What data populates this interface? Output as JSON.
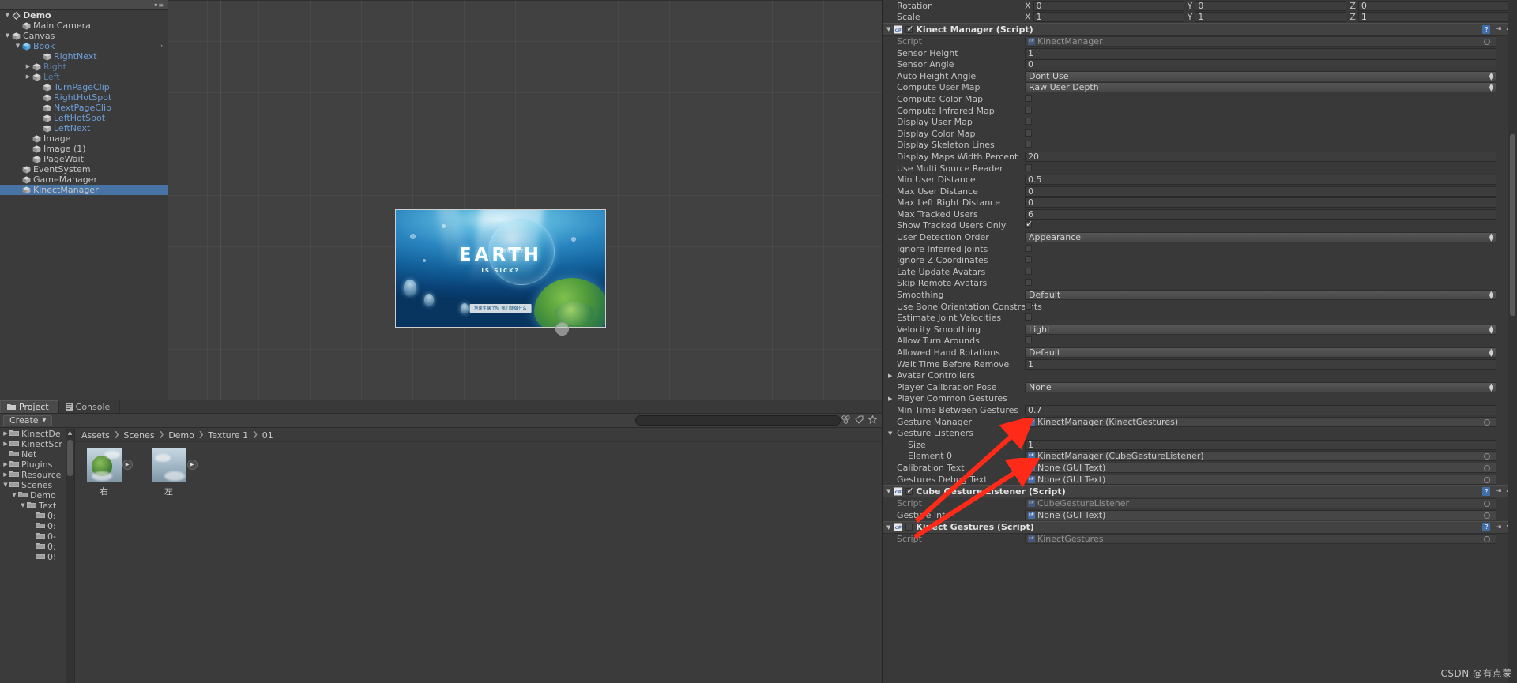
{
  "hierarchy": {
    "root": {
      "label": "Demo",
      "icon": "unity-logo-icon"
    },
    "items": [
      {
        "label": "Main Camera",
        "indent": 2,
        "twisty": "",
        "icon": "gameobject-cube-icon",
        "style": "normal"
      },
      {
        "label": "Canvas",
        "indent": 1,
        "twisty": "▼",
        "icon": "gameobject-cube-icon",
        "style": "normal"
      },
      {
        "label": "Book",
        "indent": 2,
        "twisty": "▼",
        "icon": "prefab-cube-icon",
        "style": "prefab",
        "rightArrow": "›"
      },
      {
        "label": "RightNext",
        "indent": 4,
        "twisty": "",
        "icon": "gameobject-cube-icon",
        "style": "prefab"
      },
      {
        "label": "Right",
        "indent": 3,
        "twisty": "▶",
        "icon": "gameobject-cube-icon",
        "style": "prefabdim"
      },
      {
        "label": "Left",
        "indent": 3,
        "twisty": "▶",
        "icon": "gameobject-cube-icon",
        "style": "prefabdim"
      },
      {
        "label": "TurnPageClip",
        "indent": 4,
        "twisty": "",
        "icon": "gameobject-cube-icon",
        "style": "prefab"
      },
      {
        "label": "RightHotSpot",
        "indent": 4,
        "twisty": "",
        "icon": "gameobject-cube-icon",
        "style": "prefab"
      },
      {
        "label": "NextPageClip",
        "indent": 4,
        "twisty": "",
        "icon": "gameobject-cube-icon",
        "style": "prefab"
      },
      {
        "label": "LeftHotSpot",
        "indent": 4,
        "twisty": "",
        "icon": "gameobject-cube-icon",
        "style": "prefab"
      },
      {
        "label": "LeftNext",
        "indent": 4,
        "twisty": "",
        "icon": "gameobject-cube-icon",
        "style": "prefab"
      },
      {
        "label": "Image",
        "indent": 3,
        "twisty": "",
        "icon": "gameobject-cube-icon",
        "style": "normal"
      },
      {
        "label": "Image (1)",
        "indent": 3,
        "twisty": "",
        "icon": "gameobject-cube-icon",
        "style": "normal"
      },
      {
        "label": "PageWait",
        "indent": 3,
        "twisty": "",
        "icon": "gameobject-cube-icon",
        "style": "normal"
      },
      {
        "label": "EventSystem",
        "indent": 2,
        "twisty": "",
        "icon": "gameobject-cube-icon",
        "style": "normal"
      },
      {
        "label": "GameManager",
        "indent": 2,
        "twisty": "",
        "icon": "gameobject-cube-icon",
        "style": "normal"
      },
      {
        "label": "KinectManager",
        "indent": 2,
        "twisty": "",
        "icon": "gameobject-cube-icon",
        "style": "normal",
        "selected": true
      }
    ]
  },
  "scene": {
    "poster": {
      "title": "EARTH",
      "subtitle": "IS SICK?",
      "side_text": "地球生病了吗",
      "bottom_bar": "地球生病了吗\n我们能做什么"
    }
  },
  "project": {
    "tabs": [
      {
        "label": "Project",
        "icon": "folder-icon",
        "active": true
      },
      {
        "label": "Console",
        "icon": "console-icon",
        "active": false
      }
    ],
    "create_label": "Create",
    "search_placeholder": "",
    "tree": [
      {
        "label": "KinectDe",
        "indent": 1,
        "twisty": "▶"
      },
      {
        "label": "KinectScr",
        "indent": 1,
        "twisty": "▶"
      },
      {
        "label": "Net",
        "indent": 1,
        "twisty": ""
      },
      {
        "label": "Plugins",
        "indent": 1,
        "twisty": "▶"
      },
      {
        "label": "Resource",
        "indent": 1,
        "twisty": "▶"
      },
      {
        "label": "Scenes",
        "indent": 1,
        "twisty": "▼"
      },
      {
        "label": "Demo",
        "indent": 2,
        "twisty": "▼"
      },
      {
        "label": "Text",
        "indent": 3,
        "twisty": "▼"
      },
      {
        "label": "0:",
        "indent": 4,
        "twisty": ""
      },
      {
        "label": "0:",
        "indent": 4,
        "twisty": ""
      },
      {
        "label": "0-",
        "indent": 4,
        "twisty": ""
      },
      {
        "label": "0:",
        "indent": 4,
        "twisty": ""
      },
      {
        "label": "0!",
        "indent": 4,
        "twisty": ""
      }
    ],
    "breadcrumb": [
      "Assets",
      "Scenes",
      "Demo",
      "Texture 1",
      "01"
    ],
    "assets": [
      {
        "name": "右"
      },
      {
        "name": "左"
      }
    ]
  },
  "inspector": {
    "transform_rows": [
      {
        "label": "Rotation",
        "x": "0",
        "y": "0",
        "z": "0"
      },
      {
        "label": "Scale",
        "x": "1",
        "y": "1",
        "z": "1"
      }
    ],
    "axis_labels": [
      "X",
      "Y",
      "Z"
    ],
    "components": [
      {
        "name": "Kinect Manager (Script)",
        "enabled": true,
        "expanded": true,
        "rows": [
          {
            "label": "Script",
            "type": "object",
            "value": "KinectManager",
            "dim": true
          },
          {
            "label": "Sensor Height",
            "type": "text",
            "value": "1"
          },
          {
            "label": "Sensor Angle",
            "type": "text",
            "value": "0"
          },
          {
            "label": "Auto Height Angle",
            "type": "popup",
            "value": "Dont Use"
          },
          {
            "label": "Compute User Map",
            "type": "popup",
            "value": "Raw User Depth"
          },
          {
            "label": "Compute Color Map",
            "type": "check",
            "value": false
          },
          {
            "label": "Compute Infrared Map",
            "type": "check",
            "value": false
          },
          {
            "label": "Display User Map",
            "type": "check",
            "value": false
          },
          {
            "label": "Display Color Map",
            "type": "check",
            "value": false
          },
          {
            "label": "Display Skeleton Lines",
            "type": "check",
            "value": false
          },
          {
            "label": "Display Maps Width Percent",
            "type": "text",
            "value": "20"
          },
          {
            "label": "Use Multi Source Reader",
            "type": "check",
            "value": false
          },
          {
            "label": "Min User Distance",
            "type": "text",
            "value": "0.5"
          },
          {
            "label": "Max User Distance",
            "type": "text",
            "value": "0"
          },
          {
            "label": "Max Left Right Distance",
            "type": "text",
            "value": "0"
          },
          {
            "label": "Max Tracked Users",
            "type": "text",
            "value": "6"
          },
          {
            "label": "Show Tracked Users Only",
            "type": "check",
            "value": true
          },
          {
            "label": "User Detection Order",
            "type": "popup",
            "value": "Appearance"
          },
          {
            "label": "Ignore Inferred Joints",
            "type": "check",
            "value": false
          },
          {
            "label": "Ignore Z Coordinates",
            "type": "check",
            "value": false
          },
          {
            "label": "Late Update Avatars",
            "type": "check",
            "value": false
          },
          {
            "label": "Skip Remote Avatars",
            "type": "check",
            "value": false
          },
          {
            "label": "Smoothing",
            "type": "popup",
            "value": "Default"
          },
          {
            "label": "Use Bone Orientation Constraints",
            "type": "check",
            "value": false
          },
          {
            "label": "Estimate Joint Velocities",
            "type": "check",
            "value": false
          },
          {
            "label": "Velocity Smoothing",
            "type": "popup",
            "value": "Light"
          },
          {
            "label": "Allow Turn Arounds",
            "type": "check",
            "value": false
          },
          {
            "label": "Allowed Hand Rotations",
            "type": "popup",
            "value": "Default"
          },
          {
            "label": "Wait Time Before Remove",
            "type": "text",
            "value": "1"
          },
          {
            "label": "Avatar Controllers",
            "type": "foldout",
            "value": "",
            "twisty": "▶"
          },
          {
            "label": "Player Calibration Pose",
            "type": "popup",
            "value": "None"
          },
          {
            "label": "Player Common Gestures",
            "type": "foldout",
            "value": "",
            "twisty": "▶"
          },
          {
            "label": "Min Time Between Gestures",
            "type": "text",
            "value": "0.7"
          },
          {
            "label": "Gesture Manager",
            "type": "object",
            "value": "KinectManager (KinectGestures)"
          },
          {
            "label": "Gesture Listeners",
            "type": "foldout",
            "value": "",
            "twisty": "▼"
          },
          {
            "label": "Size",
            "type": "text",
            "value": "1",
            "indent": 1
          },
          {
            "label": "Element 0",
            "type": "object",
            "value": "KinectManager (CubeGestureListener)",
            "indent": 1
          },
          {
            "label": "Calibration Text",
            "type": "object",
            "value": "None (GUI Text)"
          },
          {
            "label": "Gestures Debug Text",
            "type": "object",
            "value": "None (GUI Text)"
          }
        ]
      },
      {
        "name": "Cube Gesture Listener (Script)",
        "enabled": true,
        "expanded": true,
        "rows": [
          {
            "label": "Script",
            "type": "object",
            "value": "CubeGestureListener",
            "dim": true
          },
          {
            "label": "Gesture Info",
            "type": "object",
            "value": "None (GUI Text)"
          }
        ]
      },
      {
        "name": "Kinect Gestures (Script)",
        "enabled": false,
        "expanded": true,
        "rows": [
          {
            "label": "Script",
            "type": "object",
            "value": "KinectGestures",
            "dim": true
          }
        ]
      }
    ]
  },
  "watermark": {
    "text": "CSDN @有点蒙"
  },
  "colors": {
    "selection_blue": "#4874a5",
    "prefab_blue": "#6f9fd8",
    "panel_bg": "#393939",
    "annotation_red": "#ff2a17"
  }
}
